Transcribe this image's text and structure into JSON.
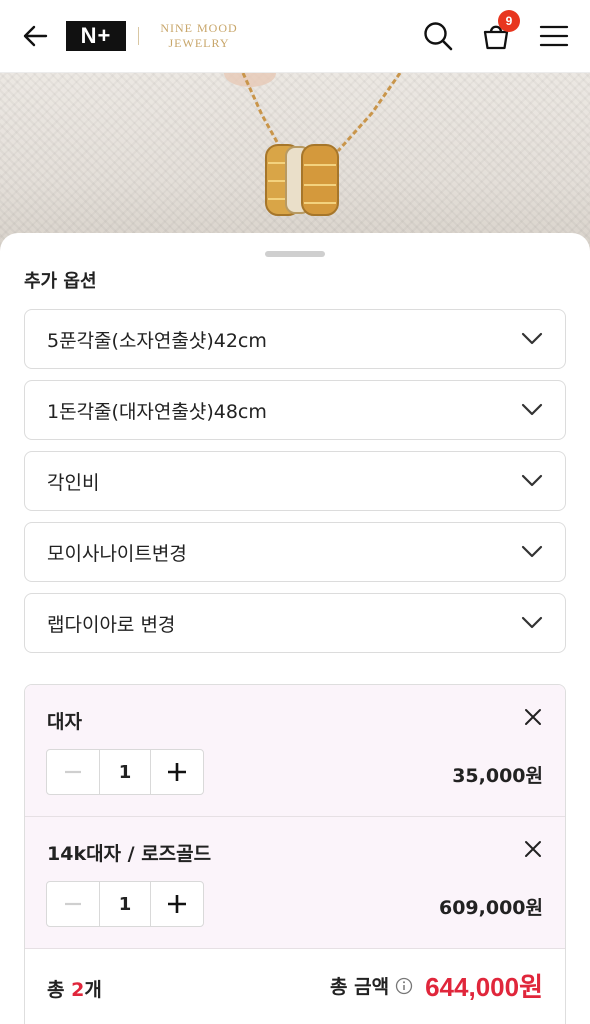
{
  "header": {
    "logo_text": "N+",
    "brand_line1": "NINE MOOD",
    "brand_line2": "JEWELRY",
    "cart_count": "9"
  },
  "sheet": {
    "section_title": "추가 옵션",
    "options": [
      {
        "label": "5푼각줄(소자연출샷)42cm"
      },
      {
        "label": "1돈각줄(대자연출샷)48cm"
      },
      {
        "label": "각인비"
      },
      {
        "label": "모이사나이트변경"
      },
      {
        "label": "랩다이아로 변경"
      }
    ]
  },
  "selected": {
    "items": [
      {
        "name": "대자",
        "qty": "1",
        "price": "35,000원"
      },
      {
        "name": "14k대자 / 로즈골드",
        "qty": "1",
        "price": "609,000원"
      }
    ],
    "total_prefix": "총 ",
    "total_count": "2",
    "total_suffix": "개",
    "total_label": "총 금액",
    "total_amount": "644,000원"
  },
  "colors": {
    "accent": "#e0263b",
    "badge": "#e8361f",
    "brand_gold": "#c8a66a",
    "selected_bg": "#fbf4fa"
  }
}
